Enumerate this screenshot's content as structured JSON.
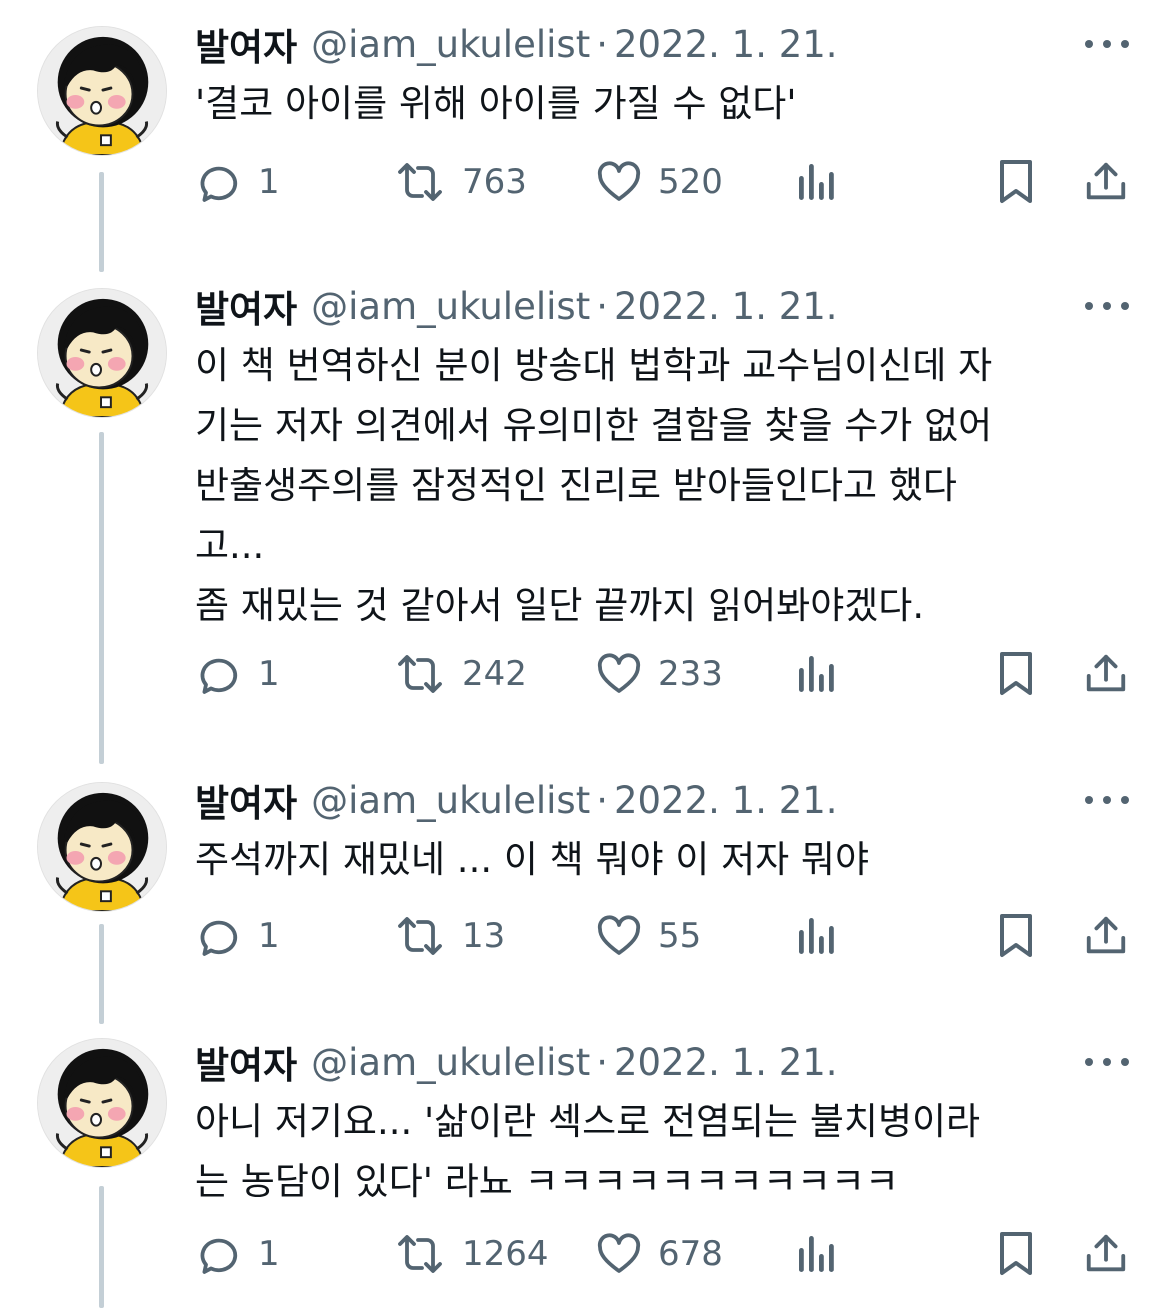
{
  "tweets": [
    {
      "name": "발여자",
      "handle": "@iam_ukulelist",
      "sep": "·",
      "date": "2022. 1. 21.",
      "lines": [
        "'결코 아이를 위해 아이를 가질 수 없다'"
      ],
      "reply_count": "1",
      "retweet_count": "763",
      "like_count": "520"
    },
    {
      "name": "발여자",
      "handle": "@iam_ukulelist",
      "sep": "·",
      "date": "2022. 1. 21.",
      "lines": [
        "이 책 번역하신 분이 방송대 법학과 교수님이신데 자",
        "기는 저자 의견에서 유의미한 결함을 찾을 수가 없어",
        "반출생주의를 잠정적인 진리로 받아들인다고 했다",
        "고...",
        "좀 재밌는 것 같아서 일단 끝까지 읽어봐야겠다."
      ],
      "reply_count": "1",
      "retweet_count": "242",
      "like_count": "233"
    },
    {
      "name": "발여자",
      "handle": "@iam_ukulelist",
      "sep": "·",
      "date": "2022. 1. 21.",
      "lines": [
        "주석까지 재밌네 ... 이 책 뭐야 이 저자 뭐야"
      ],
      "reply_count": "1",
      "retweet_count": "13",
      "like_count": "55"
    },
    {
      "name": "발여자",
      "handle": "@iam_ukulelist",
      "sep": "·",
      "date": "2022. 1. 21.",
      "lines": [
        "아니 저기요... '삶이란 섹스로 전염되는 불치병이라",
        "는 농담이 있다' 라뇨 ㅋㅋㅋㅋㅋㅋㅋㅋㅋㅋㅋ"
      ],
      "reply_count": "1",
      "retweet_count": "1264",
      "like_count": "678"
    }
  ],
  "icons": {
    "reply": "reply-icon",
    "retweet": "retweet-icon",
    "like": "heart-icon",
    "views": "views-icon",
    "bookmark": "bookmark-icon",
    "share": "share-icon",
    "more": "more-icon"
  },
  "colors": {
    "text": "#0f1419",
    "secondary": "#536471",
    "thread_line": "#c4cfd6",
    "avatar_hair": "#111111",
    "avatar_shirt": "#f5c518"
  }
}
